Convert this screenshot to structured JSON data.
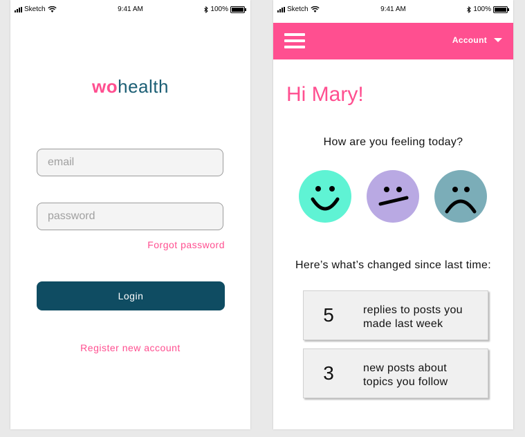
{
  "statusbar": {
    "carrier": "Sketch",
    "time": "9:41 AM",
    "battery": "100%"
  },
  "login": {
    "logo": {
      "part1": "wo",
      "part2": "health"
    },
    "email_placeholder": "email",
    "password_placeholder": "password",
    "forgot_label": "Forgot password",
    "login_label": "Login",
    "register_label": "Register new account"
  },
  "home": {
    "nav": {
      "account_label": "Account"
    },
    "greeting": "Hi Mary!",
    "question": "How are you feeling today?",
    "faces": [
      {
        "name": "happy",
        "color": "#5ff3d4"
      },
      {
        "name": "neutral",
        "color": "#b9a9e3"
      },
      {
        "name": "sad",
        "color": "#7badb8"
      }
    ],
    "changed_title": "Here’s what’s changed since last time:",
    "cards": [
      {
        "count": "5",
        "line1": "replies to posts you",
        "line2": "made last week"
      },
      {
        "count": "3",
        "line1": "new posts about",
        "line2": "topics you follow"
      }
    ]
  },
  "colors": {
    "accent": "#ff4f90",
    "primary": "#0f4c62",
    "logo_health": "#1b5e74"
  }
}
